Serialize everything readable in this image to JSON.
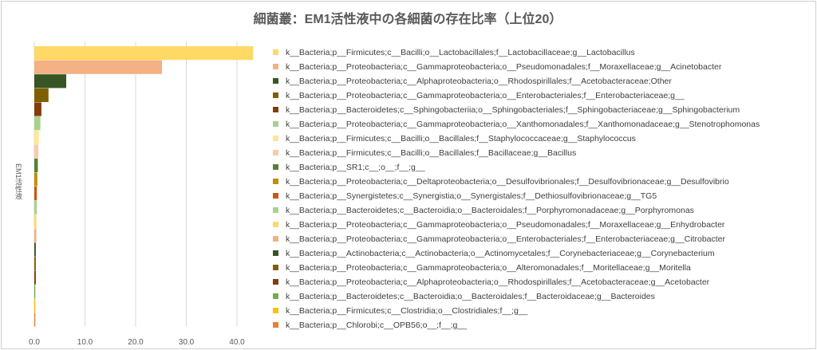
{
  "title": "細菌叢：EM1活性液中の各細菌の存在比率（上位20）",
  "chart_data": {
    "type": "bar",
    "orientation": "horizontal",
    "title": "細菌叢：EM1活性液中の各細菌の存在比率（上位20）",
    "category": "EM1活性液",
    "ylabel": "EM1活性液",
    "xlabel": "",
    "xlim": [
      0,
      45
    ],
    "xticks": [
      0,
      10,
      20,
      30,
      40
    ],
    "xtick_labels": [
      "0.0",
      "10.0",
      "20.0",
      "30.0",
      "40.0"
    ],
    "grid": true,
    "legend_position": "right",
    "series": [
      {
        "name": "k__Bacteria;p__Firmicutes;c__Bacilli;o__Lactobacillales;f__Lactobacillaceae;g__Lactobacillus",
        "value": 43.2,
        "color": "#FFD966"
      },
      {
        "name": "k__Bacteria;p__Proteobacteria;c__Gammaproteobacteria;o__Pseudomonadales;f__Moraxellaceae;g__Acinetobacter",
        "value": 25.2,
        "color": "#F4B183"
      },
      {
        "name": "k__Bacteria;p__Proteobacteria;c__Alphaproteobacteria;o__Rhodospirillales;f__Acetobacteraceae;Other",
        "value": 6.3,
        "color": "#375623"
      },
      {
        "name": "k__Bacteria;p__Proteobacteria;c__Gammaproteobacteria;o__Enterobacteriales;f__Enterobacteriaceae;g__",
        "value": 2.8,
        "color": "#7F6000"
      },
      {
        "name": "k__Bacteria;p__Bacteroidetes;c__Sphingobacteriia;o__Sphingobacteriales;f__Sphingobacteriaceae;g__Sphingobacterium",
        "value": 1.4,
        "color": "#843C0C"
      },
      {
        "name": "k__Bacteria;p__Proteobacteria;c__Gammaproteobacteria;o__Xanthomonadales;f__Xanthomonadaceae;g__Stenotrophomonas",
        "value": 1.2,
        "color": "#A9D18E"
      },
      {
        "name": "k__Bacteria;p__Firmicutes;c__Bacilli;o__Bacillales;f__Staphylococcaceae;g__Staphylococcus",
        "value": 0.9,
        "color": "#FFE699"
      },
      {
        "name": "k__Bacteria;p__Firmicutes;c__Bacilli;o__Bacillales;f__Bacillaceae;g__Bacillus",
        "value": 0.8,
        "color": "#F8CBAD"
      },
      {
        "name": "k__Bacteria;p__SR1;c__;o__;f__;g__",
        "value": 0.7,
        "color": "#548235"
      },
      {
        "name": "k__Bacteria;p__Proteobacteria;c__Deltaproteobacteria;o__Desulfovibrionales;f__Desulfovibrionaceae;g__Desulfovibrio",
        "value": 0.6,
        "color": "#BF9000"
      },
      {
        "name": "k__Bacteria;p__Synergistetes;c__Synergistia;o__Synergistales;f__Dethiosulfovibrionaceae;g__TG5",
        "value": 0.5,
        "color": "#C55A11"
      },
      {
        "name": "k__Bacteria;p__Bacteroidetes;c__Bacteroidia;o__Bacteroidales;f__Porphyromonadaceae;g__Porphyromonas",
        "value": 0.5,
        "color": "#A9D18E"
      },
      {
        "name": "k__Bacteria;p__Proteobacteria;c__Gammaproteobacteria;o__Pseudomonadales;f__Moraxellaceae;g__Enhydrobacter",
        "value": 0.4,
        "color": "#FFD966"
      },
      {
        "name": "k__Bacteria;p__Proteobacteria;c__Gammaproteobacteria;o__Enterobacteriales;f__Enterobacteriaceae;g__Citrobacter",
        "value": 0.4,
        "color": "#F4B183"
      },
      {
        "name": "k__Bacteria;p__Actinobacteria;c__Actinobacteria;o__Actinomycetales;f__Corynebacteriaceae;g__Corynebacterium",
        "value": 0.3,
        "color": "#375623"
      },
      {
        "name": "k__Bacteria;p__Proteobacteria;c__Gammaproteobacteria;o__Alteromonadales;f__Moritellaceae;g__Moritella",
        "value": 0.3,
        "color": "#7F6000"
      },
      {
        "name": "k__Bacteria;p__Proteobacteria;c__Alphaproteobacteria;o__Rhodospirillales;f__Acetobacteraceae;g__Acetobacter",
        "value": 0.3,
        "color": "#843C0C"
      },
      {
        "name": "k__Bacteria;p__Bacteroidetes;c__Bacteroidia;o__Bacteroidales;f__Bacteroidaceae;g__Bacteroides",
        "value": 0.2,
        "color": "#70AD47"
      },
      {
        "name": "k__Bacteria;p__Firmicutes;c__Clostridia;o__Clostridiales;f__;g__",
        "value": 0.2,
        "color": "#FFC000"
      },
      {
        "name": "k__Bacteria;p__Chlorobi;c__OPB56;o__;f__;g__",
        "value": 0.2,
        "color": "#ED7D31"
      }
    ]
  }
}
